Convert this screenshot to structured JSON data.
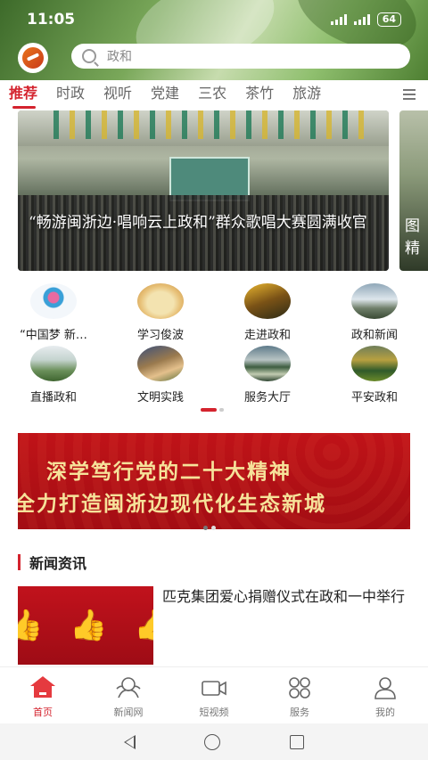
{
  "status_bar": {
    "time": "11:05",
    "battery": "64"
  },
  "search": {
    "placeholder": "政和"
  },
  "tabs": [
    {
      "label": "推荐",
      "active": true
    },
    {
      "label": "时政"
    },
    {
      "label": "视听"
    },
    {
      "label": "党建"
    },
    {
      "label": "三农"
    },
    {
      "label": "茶竹"
    },
    {
      "label": "旅游"
    }
  ],
  "banner": {
    "caption": "“畅游闽浙边·唱响云上政和”群众歌唱大赛圆满收官",
    "peek_text": "图 精"
  },
  "grid": [
    {
      "label": "“中国梦 新…",
      "icon": "chinese-dream-icon"
    },
    {
      "label": "学习俊波",
      "icon": "study-icon"
    },
    {
      "label": "走进政和",
      "icon": "explore-icon"
    },
    {
      "label": "政和新闻",
      "icon": "news-icon"
    },
    {
      "label": "直播政和",
      "icon": "live-icon"
    },
    {
      "label": "文明实践",
      "icon": "civilization-icon"
    },
    {
      "label": "服务大厅",
      "icon": "service-hall-icon"
    },
    {
      "label": "平安政和",
      "icon": "safety-icon"
    }
  ],
  "promo": {
    "line1": "深学笃行党的二十大精神",
    "line2": "全力打造闽浙边现代化生态新城"
  },
  "news_section": {
    "title": "新闻资讯",
    "items": [
      {
        "title": "匹克集团爱心捐赠仪式在政和一中举行"
      }
    ]
  },
  "bottom_nav": [
    {
      "label": "首页",
      "active": true
    },
    {
      "label": "新闻网"
    },
    {
      "label": "短视频"
    },
    {
      "label": "服务"
    },
    {
      "label": "我的"
    }
  ],
  "colors": {
    "accent": "#d4232e",
    "promo_bg": "#b30f15",
    "promo_text": "#f6e29a"
  }
}
